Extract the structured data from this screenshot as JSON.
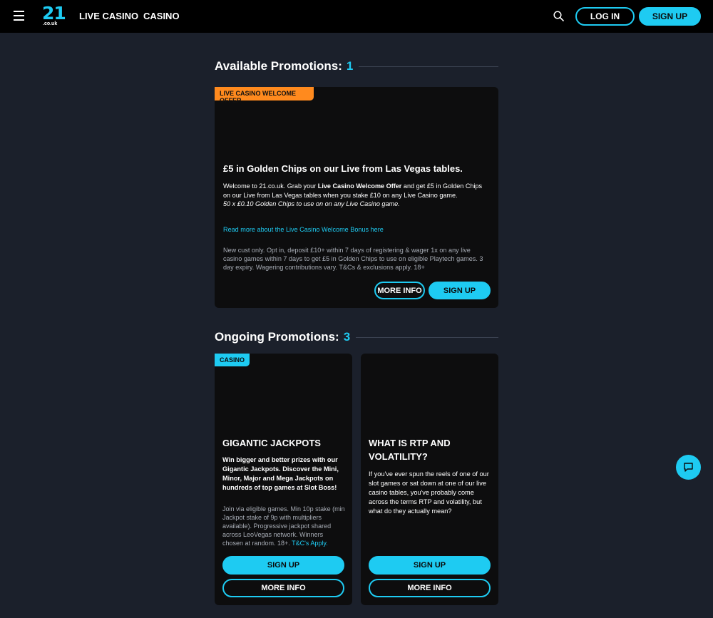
{
  "header": {
    "logo_num": "21",
    "logo_sub": ".co.uk",
    "nav": [
      "LIVE CASINO",
      "CASINO"
    ],
    "login_label": "LOG IN",
    "signup_label": "SIGN UP"
  },
  "available": {
    "heading": "Available Promotions:",
    "count": "1",
    "card": {
      "tag": "LIVE CASINO WELCOME OFFER",
      "title": "£5 in Golden Chips on our Live from Las Vegas tables.",
      "body_pre": "Welcome to 21.co.uk. Grab your ",
      "body_bold": "Live Casino Welcome Offer",
      "body_post": " and get £5 in Golden Chips on our Live from Las Vegas tables when you stake £10 on any Live Casino game.",
      "body_italic": "50 x £0.10 Golden Chips to use on on any Live Casino game.",
      "link": "Read more about the Live Casino Welcome Bonus here",
      "terms": "New cust only. Opt in, deposit £10+ within 7 days of registering & wager 1x on any live casino games within 7 days to get £5 in Golden Chips to use on eligible Playtech games. 3 day expiry. Wagering contributions vary. T&Cs & exclusions apply. 18+",
      "more_info_label": "MORE INFO",
      "signup_label": "SIGN UP"
    }
  },
  "ongoing": {
    "heading": "Ongoing Promotions:",
    "count": "3",
    "cards": [
      {
        "tag": "CASINO",
        "title": "GIGANTIC JACKPOTS",
        "body": "Win bigger and better prizes with our Gigantic Jackpots. Discover the Mini, Minor, Major and Mega Jackpots on hundreds of top games at Slot Boss!",
        "terms": "Join via eligible games. Min 10p stake (min Jackpot stake of 9p with multipliers available). Progressive jackpot shared across LeoVegas network. Winners chosen at random. 18+.",
        "tc_link": "T&C's Apply.",
        "signup_label": "SIGN UP",
        "more_info_label": "MORE INFO"
      },
      {
        "title": "WHAT IS RTP AND VOLATILITY?",
        "body": "If you've ever spun the reels of one of our slot games or sat down at one of our live casino tables, you've probably come across the terms RTP and volatility, but what do they actually mean?",
        "signup_label": "SIGN UP",
        "more_info_label": "MORE INFO"
      }
    ]
  },
  "icons": {
    "menu": "hamburger-icon",
    "search": "search-icon",
    "chat": "chat-icon"
  },
  "colors": {
    "accent": "#1ecbf2",
    "offer_tag": "#ff8a1e",
    "background": "#1b202b",
    "card": "#0d0d0e"
  }
}
